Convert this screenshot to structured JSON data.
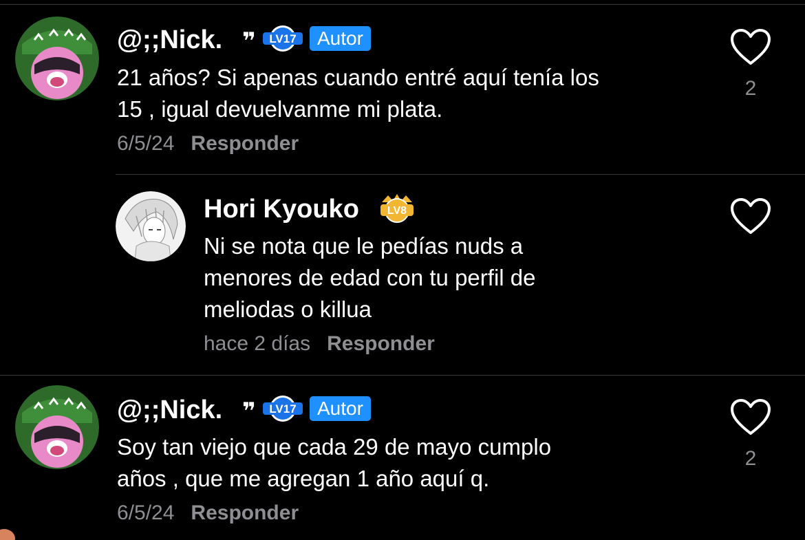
{
  "comments": [
    {
      "username": "@;;Nick.",
      "level": "LV17",
      "role": "Autor",
      "text": "21 años? Si apenas cuando entré aquí tenía los\n15 , igual devuelvanme mi plata.",
      "date": "6/5/24",
      "reply_label": "Responder",
      "like_count": "2"
    },
    {
      "username": "Hori Kyouko",
      "level": "LV8",
      "text": "Ni se nota que le pedías nuds a\nmenores de edad con tu perfil de\nmeliodas o killua",
      "date": "hace 2 días",
      "reply_label": "Responder"
    },
    {
      "username": "@;;Nick.",
      "level": "LV17",
      "role": "Autor",
      "text": "Soy tan viejo que cada 29 de mayo cumplo\naños , que me agregan 1 año aquí q.",
      "date": "6/5/24",
      "reply_label": "Responder",
      "like_count": "2"
    }
  ],
  "icons": {
    "quote": "quote-icon",
    "like": "heart-outline-icon",
    "level_badge_blue": "level-badge-blue",
    "level_badge_gold": "level-crown-badge"
  },
  "colors": {
    "background": "#000000",
    "role_badge": "#1e90ff",
    "level_blue": "#1a73e8",
    "level_gold": "#f2b632",
    "muted_text": "#8e8e93"
  }
}
